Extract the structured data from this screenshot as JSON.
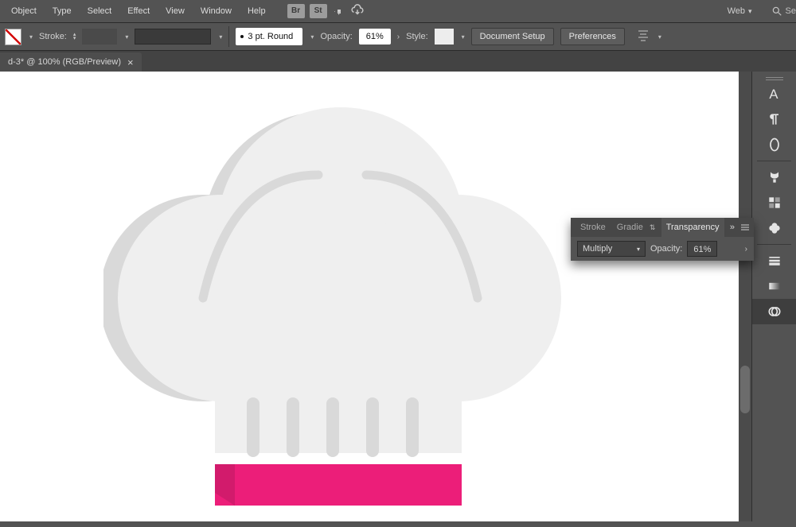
{
  "menu": {
    "items": [
      "Object",
      "Type",
      "Select",
      "Effect",
      "View",
      "Window",
      "Help"
    ],
    "bridge": "Br",
    "stock": "St",
    "workspace": "Web",
    "search_placeholder": "Se"
  },
  "options": {
    "stroke_label": "Stroke:",
    "stroke_profile": "3 pt. Round",
    "opacity_label": "Opacity:",
    "opacity_value": "61%",
    "style_label": "Style:",
    "doc_setup": "Document Setup",
    "prefs": "Preferences"
  },
  "tab": {
    "title": "d-3* @ 100% (RGB/Preview)",
    "close": "×"
  },
  "panel": {
    "t_stroke": "Stroke",
    "t_grad": "Gradie",
    "t_trans": "Transparency",
    "expand": "»",
    "blend": "Multiply",
    "opacity_l": "Opacity:",
    "opacity_v": "61%",
    "more": "›"
  },
  "artwork": {
    "hat_fill": "#EFEFEF",
    "hat_shade": "#D9D9D9",
    "band_fill": "#EC1E79",
    "band_shade": "#D21B6C"
  }
}
